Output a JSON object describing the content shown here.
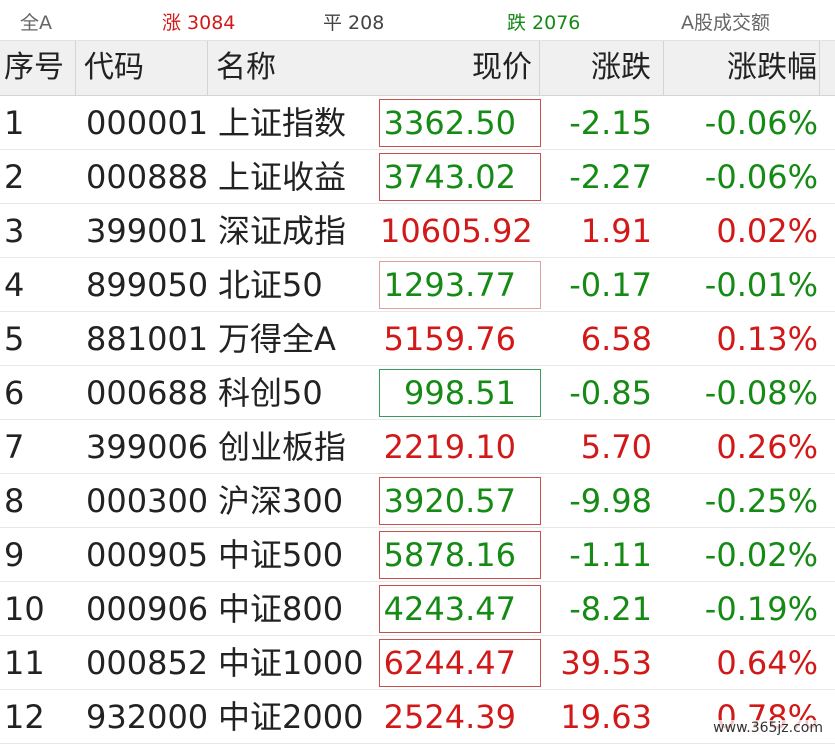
{
  "topbar": {
    "all": "全A",
    "up": "涨 3084",
    "flat": "平 208",
    "down": "跌 2076",
    "turnover": "A股成交额"
  },
  "columns": {
    "idx": "序号",
    "code": "代码",
    "name": "名称",
    "price": "现价",
    "change": "涨跌",
    "pct": "涨跌幅"
  },
  "rows": [
    {
      "idx": "1",
      "code": "000001",
      "name": "上证指数",
      "price": "3362.50",
      "change": "-2.15",
      "pct": "-0.06%",
      "dir": "down",
      "box": "red"
    },
    {
      "idx": "2",
      "code": "000888",
      "name": "上证收益",
      "price": "3743.02",
      "change": "-2.27",
      "pct": "-0.06%",
      "dir": "down",
      "box": "red"
    },
    {
      "idx": "3",
      "code": "399001",
      "name": "深证成指",
      "price": "10605.92",
      "change": "1.91",
      "pct": "0.02%",
      "dir": "up",
      "box": "none"
    },
    {
      "idx": "4",
      "code": "899050",
      "name": "北证50",
      "price": "1293.77",
      "change": "-0.17",
      "pct": "-0.01%",
      "dir": "down",
      "box": "light"
    },
    {
      "idx": "5",
      "code": "881001",
      "name": "万得全A",
      "price": "5159.76",
      "change": "6.58",
      "pct": "0.13%",
      "dir": "up",
      "box": "none"
    },
    {
      "idx": "6",
      "code": "000688",
      "name": "科创50",
      "price": "998.51",
      "change": "-0.85",
      "pct": "-0.08%",
      "dir": "down",
      "box": "green"
    },
    {
      "idx": "7",
      "code": "399006",
      "name": "创业板指",
      "price": "2219.10",
      "change": "5.70",
      "pct": "0.26%",
      "dir": "up",
      "box": "none"
    },
    {
      "idx": "8",
      "code": "000300",
      "name": "沪深300",
      "price": "3920.57",
      "change": "-9.98",
      "pct": "-0.25%",
      "dir": "down",
      "box": "red"
    },
    {
      "idx": "9",
      "code": "000905",
      "name": "中证500",
      "price": "5878.16",
      "change": "-1.11",
      "pct": "-0.02%",
      "dir": "down",
      "box": "red"
    },
    {
      "idx": "10",
      "code": "000906",
      "name": "中证800",
      "price": "4243.47",
      "change": "-8.21",
      "pct": "-0.19%",
      "dir": "down",
      "box": "red"
    },
    {
      "idx": "11",
      "code": "000852",
      "name": "中证1000",
      "price": "6244.47",
      "change": "39.53",
      "pct": "0.64%",
      "dir": "up",
      "box": "red"
    },
    {
      "idx": "12",
      "code": "932000",
      "name": "中证2000",
      "price": "2524.39",
      "change": "19.63",
      "pct": "0.78%",
      "dir": "up",
      "box": "none"
    }
  ],
  "watermark": "www.365jz.com",
  "colors": {
    "up": "#d21919",
    "down": "#158a15"
  }
}
